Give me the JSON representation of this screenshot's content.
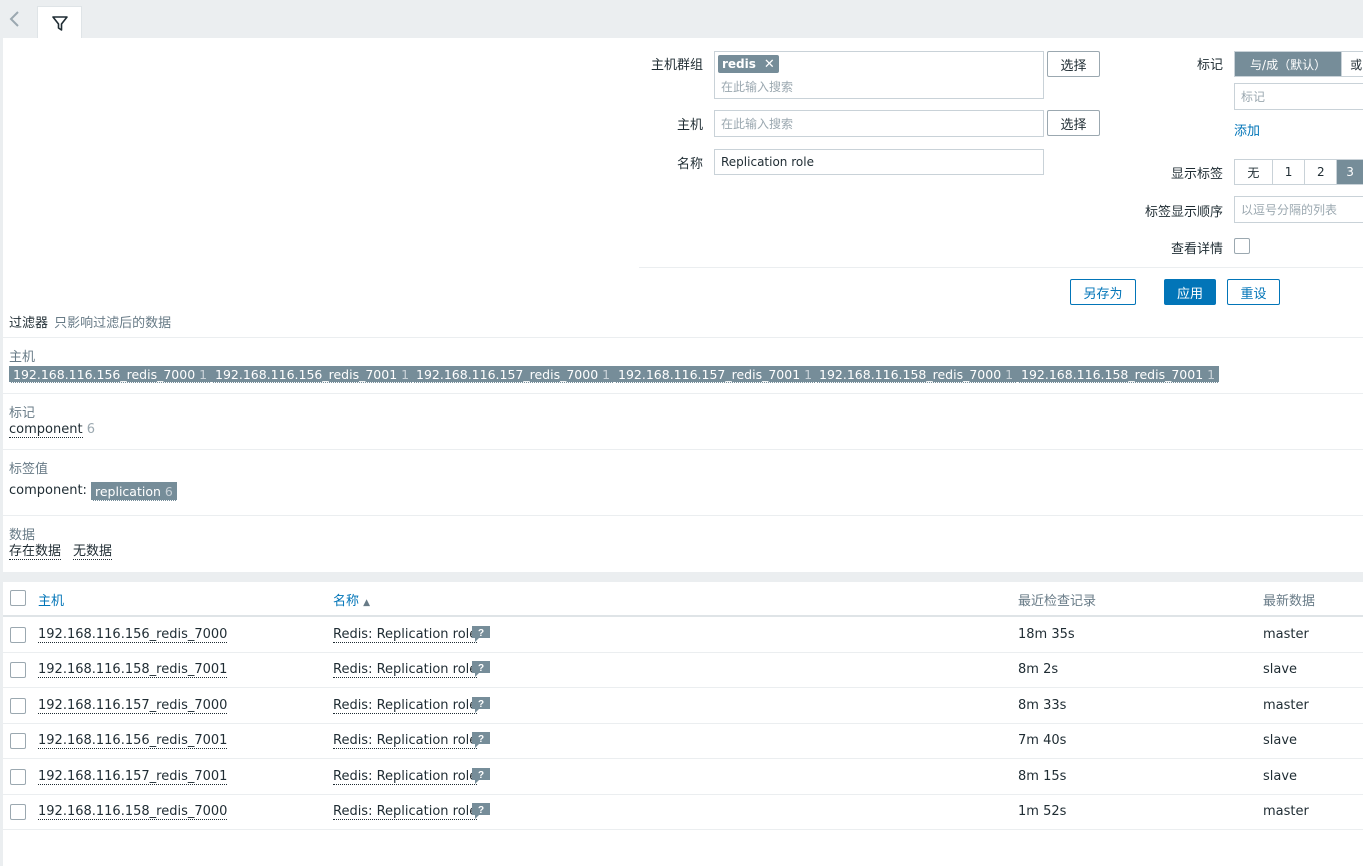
{
  "tabbar": {
    "back_icon": "chevron-left-icon",
    "filter_icon": "funnel-icon"
  },
  "filter": {
    "host_groups_label": "主机群组",
    "host_groups_chip": "redis",
    "host_groups_placeholder": "在此输入搜索",
    "select_label": "选择",
    "hosts_label": "主机",
    "hosts_placeholder": "在此输入搜索",
    "name_label": "名称",
    "name_value": "Replication role",
    "tags_label": "标记",
    "tags_mode_and_or": "与/成（默认）",
    "tags_mode_or": "或",
    "tag_placeholder": "标记",
    "add_link": "添加",
    "show_tags_label": "显示标签",
    "show_tags_options": [
      "无",
      "1",
      "2",
      "3"
    ],
    "tag_order_label": "标签显示顺序",
    "tag_order_placeholder": "以逗号分隔的列表",
    "show_details_label": "查看详情",
    "save_as": "另存为",
    "apply": "应用",
    "reset": "重设"
  },
  "subfilter": {
    "title": "过滤器",
    "note": "只影响过滤后的数据",
    "hosts_title": "主机",
    "hosts": [
      {
        "name": "192.168.116.156_redis_7000",
        "count": "1"
      },
      {
        "name": "192.168.116.156_redis_7001",
        "count": "1"
      },
      {
        "name": "192.168.116.157_redis_7000",
        "count": "1"
      },
      {
        "name": "192.168.116.157_redis_7001",
        "count": "1"
      },
      {
        "name": "192.168.116.158_redis_7000",
        "count": "1"
      },
      {
        "name": "192.168.116.158_redis_7001",
        "count": "1"
      }
    ],
    "tags_title": "标记",
    "tag_name": "component",
    "tag_count": "6",
    "tag_values_title": "标签值",
    "tag_value_key": "component:",
    "tag_value": "replication",
    "tag_value_count": "6",
    "data_title": "数据",
    "data_with": "存在数据",
    "data_without": "无数据"
  },
  "table": {
    "columns": {
      "host": "主机",
      "name": "名称",
      "last_check": "最近检查记录",
      "last_value": "最新数据"
    },
    "sort_indicator": "▲",
    "rows": [
      {
        "host": "192.168.116.156_redis_7000",
        "name": "Redis: Replication role",
        "last_check": "18m 35s",
        "last_value": "master"
      },
      {
        "host": "192.168.116.158_redis_7001",
        "name": "Redis: Replication role",
        "last_check": "8m 2s",
        "last_value": "slave"
      },
      {
        "host": "192.168.116.157_redis_7000",
        "name": "Redis: Replication role",
        "last_check": "8m 33s",
        "last_value": "master"
      },
      {
        "host": "192.168.116.156_redis_7001",
        "name": "Redis: Replication role",
        "last_check": "7m 40s",
        "last_value": "slave"
      },
      {
        "host": "192.168.116.157_redis_7001",
        "name": "Redis: Replication role",
        "last_check": "8m 15s",
        "last_value": "slave"
      },
      {
        "host": "192.168.116.158_redis_7000",
        "name": "Redis: Replication role",
        "last_check": "1m 52s",
        "last_value": "master"
      }
    ]
  }
}
